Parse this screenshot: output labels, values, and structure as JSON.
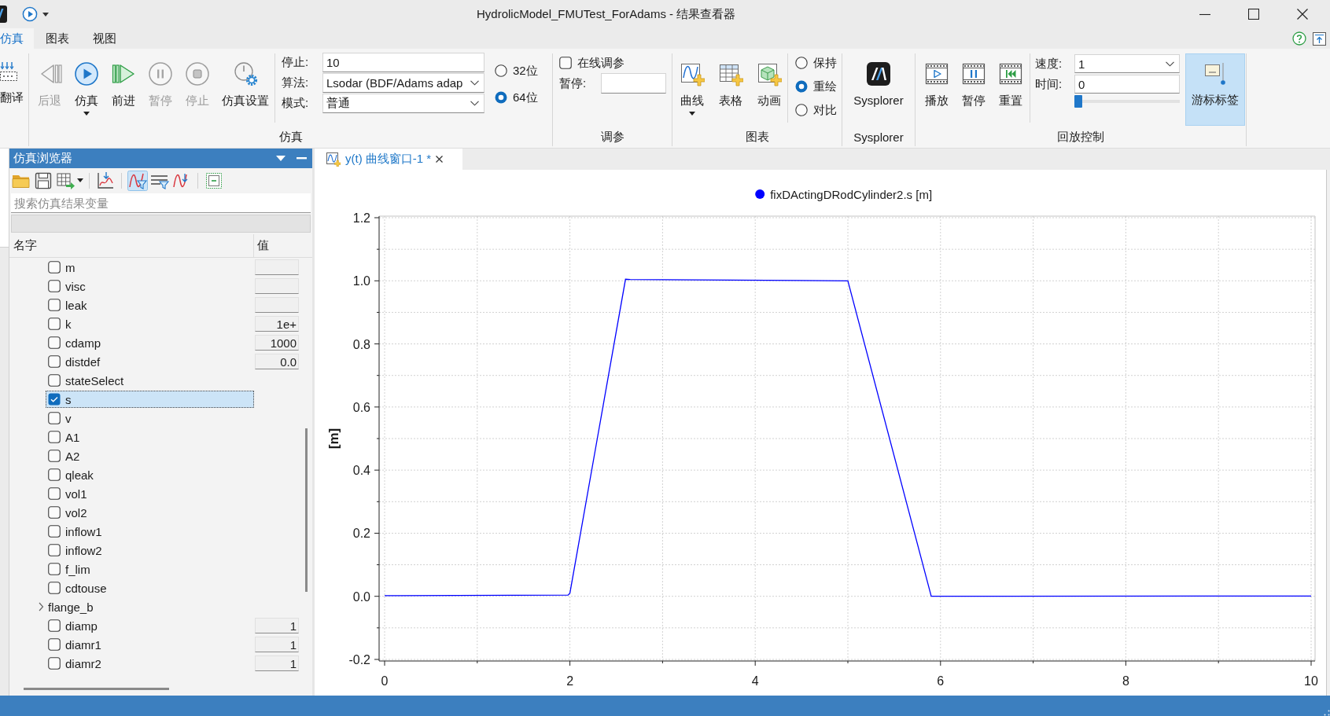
{
  "window": {
    "title": "HydrolicModel_FMUTest_ForAdams - 结果查看器"
  },
  "menu_tabs": [
    {
      "label": "仿真",
      "selected": true
    },
    {
      "label": "图表",
      "selected": false
    },
    {
      "label": "视图",
      "selected": false
    }
  ],
  "ribbon": {
    "compile": {
      "label": "翻译"
    },
    "simulation": {
      "title": "仿真",
      "buttons": [
        {
          "kind": "back",
          "label": "后退",
          "disabled": true,
          "dropdown": false
        },
        {
          "kind": "run",
          "label": "仿真",
          "disabled": false,
          "dropdown": true
        },
        {
          "kind": "forward",
          "label": "前进",
          "disabled": false,
          "dropdown": false
        },
        {
          "kind": "pause",
          "label": "暂停",
          "disabled": true,
          "dropdown": false
        },
        {
          "kind": "stop",
          "label": "停止",
          "disabled": true,
          "dropdown": false
        },
        {
          "kind": "settings",
          "label": "仿真设置",
          "disabled": false,
          "dropdown": false
        }
      ],
      "fields": [
        {
          "kind": "text",
          "label": "停止:",
          "value": "10"
        },
        {
          "kind": "dropdown",
          "label": "算法:",
          "value": "Lsodar (BDF/Adams adap"
        },
        {
          "kind": "dropdown",
          "label": "模式:",
          "value": "普通"
        }
      ],
      "precision": [
        {
          "label": "32位",
          "selected": false
        },
        {
          "label": "64位",
          "selected": true
        }
      ]
    },
    "tuning": {
      "title": "调参",
      "online": {
        "label": "在线调参",
        "checked": false
      },
      "pause": {
        "label": "暂停:"
      }
    },
    "charts": {
      "title": "图表",
      "buttons": [
        {
          "kind": "curve",
          "label": "曲线",
          "dropdown": true
        },
        {
          "kind": "table",
          "label": "表格",
          "dropdown": false
        },
        {
          "kind": "animation",
          "label": "动画",
          "dropdown": false
        }
      ],
      "modes": [
        {
          "label": "保持",
          "selected": false
        },
        {
          "label": "重绘",
          "selected": true
        },
        {
          "label": "对比",
          "selected": false
        }
      ]
    },
    "sysplorer": {
      "title": "Sysplorer",
      "button": {
        "label": "Sysplorer"
      }
    },
    "playback": {
      "title": "回放控制",
      "buttons": [
        {
          "kind": "play",
          "label": "播放"
        },
        {
          "kind": "pause",
          "label": "暂停"
        },
        {
          "kind": "reset",
          "label": "重置"
        }
      ],
      "speed": {
        "label": "速度:",
        "value": "1"
      },
      "time": {
        "label": "时间:",
        "value": "0"
      },
      "slider": {
        "level": 0
      },
      "cursor_label": {
        "label": "游标标签",
        "on": true
      }
    }
  },
  "browser": {
    "title": "仿真浏览器",
    "toolbar": [
      [
        {
          "kind": "folder",
          "on": false,
          "dropdown": false
        },
        {
          "kind": "save",
          "on": false,
          "dropdown": false
        },
        {
          "kind": "export",
          "on": false,
          "dropdown": true
        }
      ],
      [
        {
          "kind": "plot",
          "on": false,
          "dropdown": false
        }
      ],
      [
        {
          "kind": "curve-filter",
          "on": true,
          "dropdown": false
        },
        {
          "kind": "line-filter",
          "on": false,
          "dropdown": false
        },
        {
          "kind": "curve-pick",
          "on": false,
          "dropdown": false
        }
      ],
      [
        {
          "kind": "collapse",
          "on": false,
          "dropdown": false
        }
      ]
    ],
    "search": {
      "placeholder": "搜索仿真结果变量"
    },
    "columns": [
      "名字",
      "值"
    ],
    "rows": [
      {
        "kind": "param",
        "name": "m",
        "checked": false,
        "selected": false
      },
      {
        "kind": "param",
        "name": "visc",
        "checked": false,
        "selected": false
      },
      {
        "kind": "param",
        "name": "leak",
        "checked": false,
        "selected": false
      },
      {
        "kind": "param",
        "name": "k",
        "value": "1e+",
        "checked": false,
        "selected": false
      },
      {
        "kind": "param",
        "name": "cdamp",
        "value": "1000",
        "checked": false,
        "selected": false
      },
      {
        "kind": "param",
        "name": "distdef",
        "value": "0.0",
        "checked": false,
        "selected": false
      },
      {
        "kind": "variable",
        "name": "stateSelect",
        "checked": false,
        "selected": false
      },
      {
        "kind": "variable",
        "name": "s",
        "checked": true,
        "selected": true
      },
      {
        "kind": "variable",
        "name": "v",
        "checked": false,
        "selected": false
      },
      {
        "kind": "variable",
        "name": "A1",
        "checked": false,
        "selected": false
      },
      {
        "kind": "variable",
        "name": "A2",
        "checked": false,
        "selected": false
      },
      {
        "kind": "variable",
        "name": "qleak",
        "checked": false,
        "selected": false
      },
      {
        "kind": "variable",
        "name": "vol1",
        "checked": false,
        "selected": false
      },
      {
        "kind": "variable",
        "name": "vol2",
        "checked": false,
        "selected": false
      },
      {
        "kind": "variable",
        "name": "inflow1",
        "checked": false,
        "selected": false
      },
      {
        "kind": "variable",
        "name": "inflow2",
        "checked": false,
        "selected": false
      },
      {
        "kind": "variable",
        "name": "f_lim",
        "checked": false,
        "selected": false
      },
      {
        "kind": "variable",
        "name": "cdtouse",
        "checked": false,
        "selected": false
      },
      {
        "kind": "group",
        "name": "flange_b",
        "expanded": false,
        "selected": false
      },
      {
        "kind": "param",
        "name": "diamp",
        "value": "1",
        "checked": false,
        "selected": false
      },
      {
        "kind": "param",
        "name": "diamr1",
        "value": "1",
        "checked": false,
        "selected": false
      },
      {
        "kind": "param",
        "name": "diamr2",
        "value": "1",
        "checked": false,
        "selected": false
      }
    ]
  },
  "plot_tabs": [
    {
      "label": "y(t) 曲线窗口-1 *",
      "selected": true
    }
  ],
  "chart": {
    "chart_data": {
      "type": "line",
      "ylabel": "[m]",
      "grid": true,
      "x": [
        0,
        1.98,
        2.0,
        2.6,
        2.65,
        5.0,
        5.9,
        10
      ],
      "series": [
        {
          "name": "fixDActingDRodCylinder2.s [m]",
          "color": "#0000ff",
          "values": [
            0.002,
            0.004,
            0.01,
            1.005,
            1.004,
            1.0,
            0.0,
            0.001
          ]
        }
      ],
      "xlim": [
        0,
        10
      ],
      "ylim": [
        -0.2,
        1.2
      ],
      "xticks": [
        0,
        2,
        4,
        6,
        8,
        10
      ],
      "yticks": [
        {
          "value": -0.2,
          "label": "-0.2"
        },
        {
          "value": 0,
          "label": "0.0"
        },
        {
          "value": 0.2,
          "label": "0.2"
        },
        {
          "value": 0.4,
          "label": "0.4"
        },
        {
          "value": 0.6,
          "label": "0.6"
        },
        {
          "value": 0.8,
          "label": "0.8"
        },
        {
          "value": 1,
          "label": "1.0"
        },
        {
          "value": 1.2,
          "label": "1.2"
        }
      ]
    }
  }
}
